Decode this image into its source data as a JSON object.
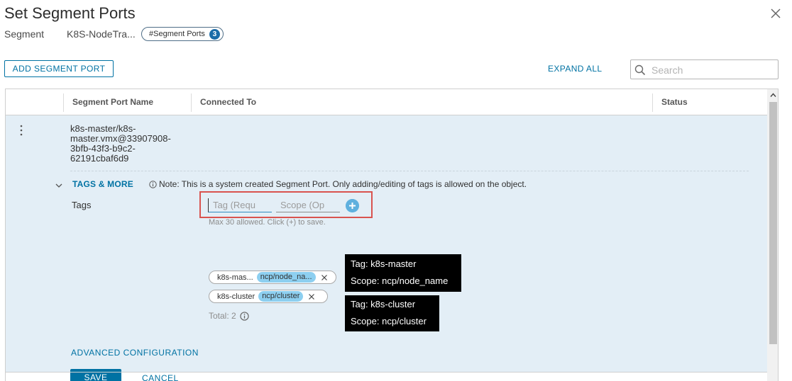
{
  "dialog": {
    "title": "Set Segment Ports",
    "segment_label": "Segment",
    "segment_name": "K8S-NodeTra...",
    "segment_ports_pill": "#Segment Ports",
    "segment_ports_count": "3"
  },
  "toolbar": {
    "add_label": "ADD SEGMENT PORT",
    "expand_all_label": "EXPAND ALL",
    "search_placeholder": "Search"
  },
  "grid": {
    "columns": [
      "Segment Port Name",
      "Connected To",
      "Status"
    ],
    "rows": [
      {
        "port_name": "k8s-master/k8s-master.vmx@33907908-3bfb-43f3-b9c2-62191cbaf6d9",
        "connected_to": "",
        "status": ""
      }
    ]
  },
  "details": {
    "tags_more_label": "TAGS & MORE",
    "note": "Note: This is a system created Segment Port. Only adding/editing of tags is allowed on the object.",
    "tags_label": "Tags",
    "tag_placeholder": "Tag (Requ",
    "scope_placeholder": "Scope (Op",
    "max_note": "Max 30 allowed. Click (+) to save.",
    "chips": [
      {
        "tag": "k8s-mas...",
        "scope": "ncp/node_na..."
      },
      {
        "tag": "k8s-cluster",
        "scope": "ncp/cluster"
      }
    ],
    "total_label": "Total: 2"
  },
  "tooltips": [
    {
      "tag_line": "Tag: k8s-master",
      "scope_line": "Scope: ncp/node_name"
    },
    {
      "tag_line": "Tag: k8s-cluster",
      "scope_line": "Scope: ncp/cluster"
    }
  ],
  "actions": {
    "advanced_label": "ADVANCED CONFIGURATION",
    "save_label": "SAVE",
    "cancel_label": "CANCEL"
  },
  "colors": {
    "accent": "#0072a3",
    "row_selected_bg": "#e3eef6",
    "highlight_border": "#d9534f",
    "scope_badge": "#8dcff0",
    "tooltip_bg": "#000000"
  },
  "icons": [
    "close-icon",
    "search-icon",
    "kebab-menu-icon",
    "chevron-down-icon",
    "info-icon",
    "plus-circle-icon",
    "remove-icon",
    "scroll-up-icon"
  ]
}
